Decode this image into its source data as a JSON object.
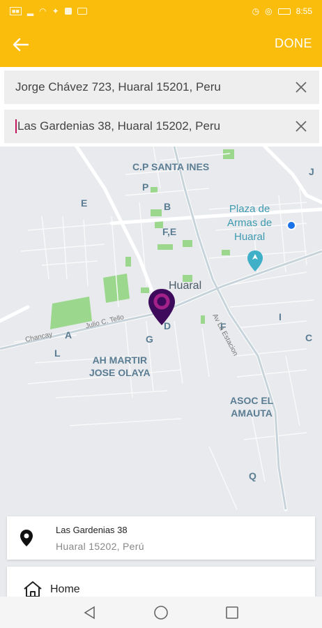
{
  "status_bar": {
    "time": "8:55",
    "left_icons": [
      "sim-icon",
      "signal-icon",
      "wifi-icon",
      "twitter-icon",
      "app-icon",
      "image-icon"
    ],
    "right_icons": [
      "alarm-icon",
      "location-icon",
      "battery-icon"
    ]
  },
  "app_bar": {
    "back_icon": "arrow-left-icon",
    "done_label": "DONE",
    "accent": "#fbbd0c"
  },
  "route": {
    "origin": "Jorge Chávez 723, Huaral 15201, Peru",
    "destination": "Las Gardenias 38, Huaral 15202, Peru"
  },
  "map": {
    "area_labels": [
      "C.P SANTA INES",
      "AH MARTIR\nJOSE OLAYA",
      "ASOC EL\nAMAUTA"
    ],
    "sector_letters": [
      "P",
      "B",
      "E",
      "F,E",
      "A",
      "L",
      "G",
      "D",
      "F",
      "I",
      "C",
      "Q",
      "J"
    ],
    "city_label": "Huaral",
    "poi_label": "Plaza de\nArmas de\nHuaral",
    "streets": [
      "Av La Estacion",
      "Julio C. Tello",
      "Chancay"
    ],
    "pin_color": "#3d0a5c",
    "pin_ring": "#a2228a"
  },
  "result": {
    "title": "Las Gardenias 38",
    "subtitle": "Huaral 15202, Perú",
    "icon": "map-pin-icon"
  },
  "home": {
    "label": "Home",
    "icon": "home-icon"
  },
  "nav": {
    "back_icon": "nav-back-icon",
    "home_icon": "nav-home-icon",
    "recents_icon": "nav-recents-icon"
  }
}
